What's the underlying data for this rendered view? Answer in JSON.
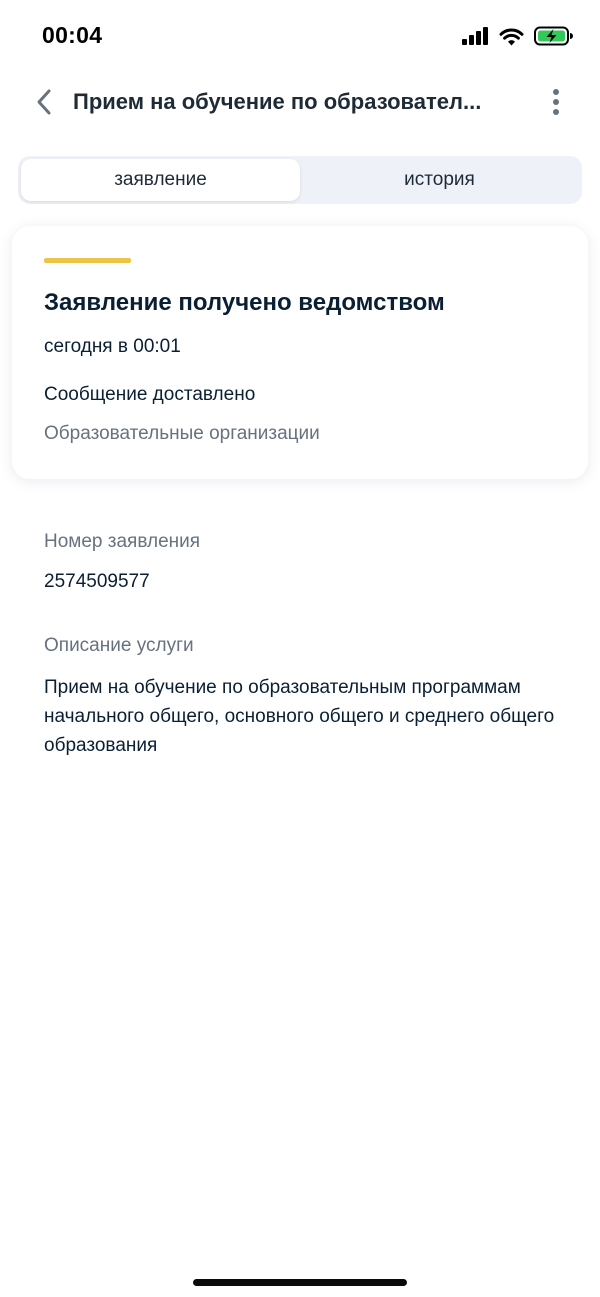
{
  "status_bar": {
    "time": "00:04",
    "icons": [
      "cellular-signal-icon",
      "wifi-icon",
      "battery-charging-icon"
    ]
  },
  "header": {
    "back_icon": "chevron-left-icon",
    "title": "Прием на обучение по образовател...",
    "menu_icon": "more-vertical-icon"
  },
  "tabs": [
    {
      "label": "заявление",
      "active": true
    },
    {
      "label": "история",
      "active": false
    }
  ],
  "status_card": {
    "accent_color": "#efc345",
    "title": "Заявление получено ведомством",
    "date": "сегодня в 00:01",
    "message": "Сообщение доставлено",
    "organization": "Образовательные организации"
  },
  "details": {
    "number_label": "Номер заявления",
    "number_value": "2574509577",
    "description_label": "Описание услуги",
    "description_value": "Прием на обучение по образовательным программам начального общего, основного общего и среднего общего образования"
  },
  "colors": {
    "text_primary": "#0b1f33",
    "text_secondary": "#66727f",
    "tabs_background": "#eef2f8",
    "battery_fill": "#34c759"
  }
}
